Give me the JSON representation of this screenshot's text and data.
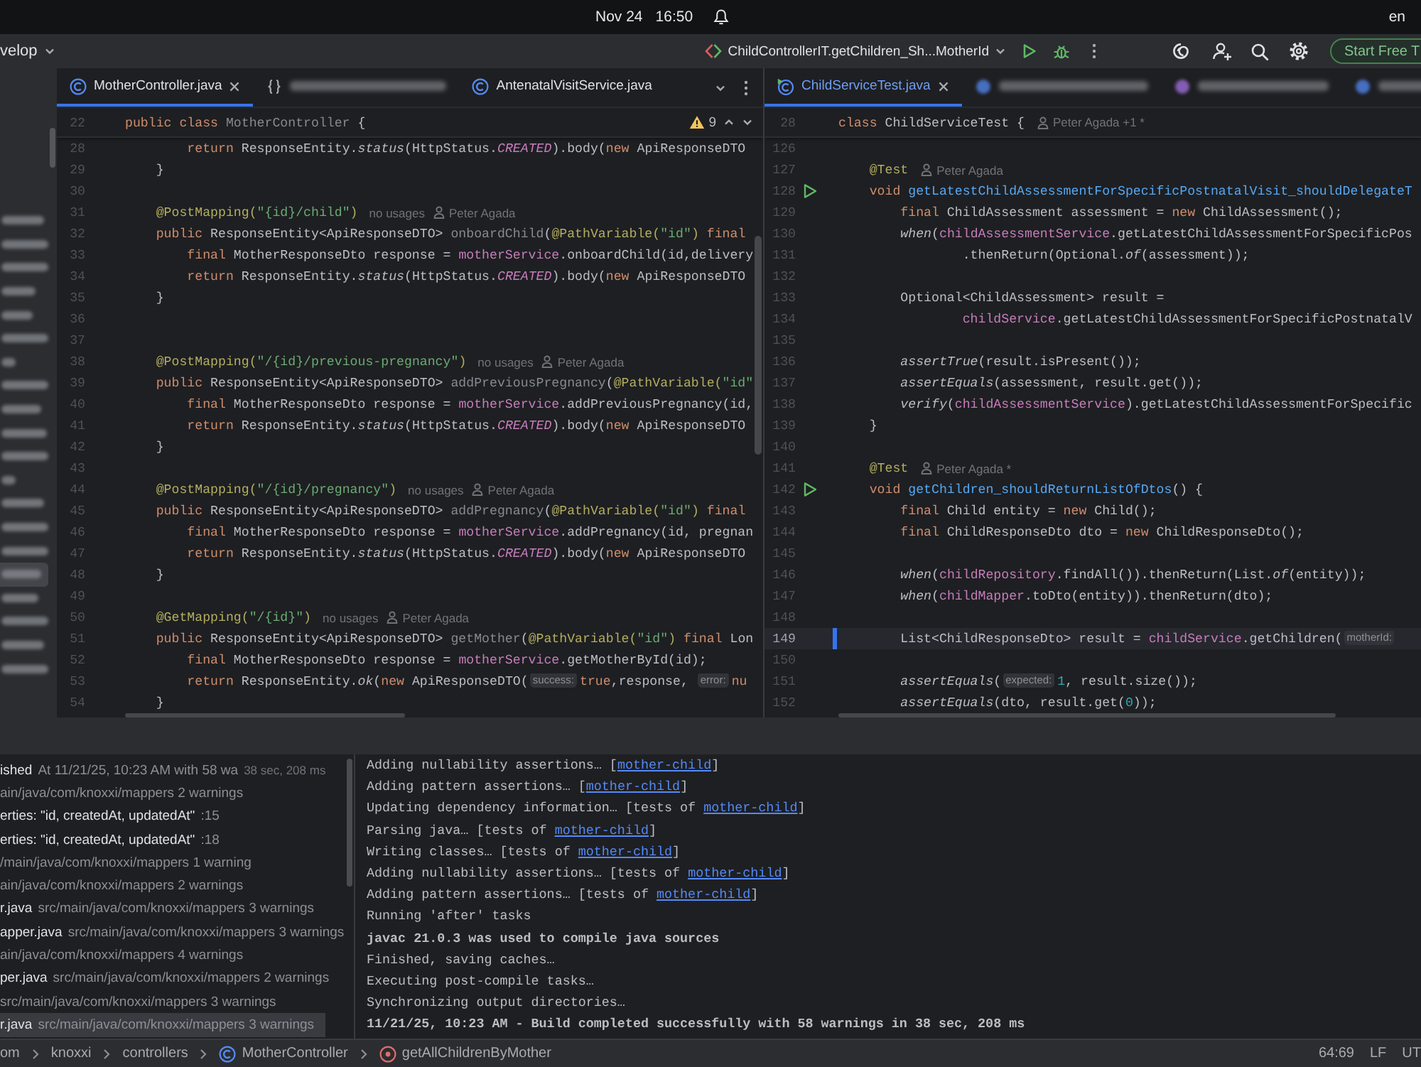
{
  "system_bar": {
    "date": "Nov 24",
    "time": "16:50",
    "language": "en"
  },
  "title_bar": {
    "branch": "velop",
    "run_configuration": "ChildControllerIT.getChildren_Sh...MotherId",
    "trial_button": "Start Free T"
  },
  "project_panel": {
    "items": [
      {
        "selected": false
      },
      {
        "selected": false
      },
      {
        "selected": false
      },
      {
        "selected": false
      },
      {
        "selected": false
      },
      {
        "selected": false
      },
      {
        "selected": false
      },
      {
        "selected": false
      },
      {
        "selected": false
      },
      {
        "selected": false
      },
      {
        "selected": false
      },
      {
        "selected": false
      },
      {
        "selected": false
      },
      {
        "selected": false
      },
      {
        "selected": false
      },
      {
        "selected": true
      },
      {
        "selected": false
      },
      {
        "selected": false
      },
      {
        "selected": false
      },
      {
        "selected": false
      }
    ]
  },
  "left_editor": {
    "tabs": [
      {
        "kind": "class",
        "label": "MotherController.java",
        "selected": true,
        "modified": false,
        "redacted": false
      },
      {
        "kind": "json",
        "selected": false,
        "redacted": true
      },
      {
        "kind": "class",
        "label": "AntenatalVisitService.java",
        "selected": false,
        "modified": false,
        "redacted": false
      }
    ],
    "problems": "9",
    "sticky_line": {
      "number": "22",
      "tokens": [
        {
          "kind": "kw",
          "text": "public class "
        },
        {
          "kind": "unused",
          "text": "MotherController"
        },
        {
          "kind": "plain",
          "text": " {"
        }
      ]
    },
    "lines": [
      {
        "number": "28",
        "tokens": [
          {
            "kind": "kw",
            "text": "        return "
          },
          {
            "kind": "plain",
            "text": "ResponseEntity."
          },
          {
            "kind": "static",
            "text": "status"
          },
          {
            "kind": "plain",
            "text": "(HttpStatus."
          },
          {
            "kind": "const",
            "text": "CREATED"
          },
          {
            "kind": "plain",
            "text": ").body("
          },
          {
            "kind": "kw",
            "text": "new "
          },
          {
            "kind": "plain",
            "text": "ApiResponseDTO"
          }
        ]
      },
      {
        "number": "29",
        "tokens": [
          {
            "kind": "plain",
            "text": "    }"
          }
        ]
      },
      {
        "number": "30"
      },
      {
        "number": "31",
        "tokens": [
          {
            "kind": "ann",
            "text": "    @PostMapping("
          },
          {
            "kind": "str",
            "text": "\"{id}/child\""
          },
          {
            "kind": "ann",
            "text": ")"
          }
        ],
        "usages": "no usages",
        "author": "Peter Agada"
      },
      {
        "number": "32",
        "tokens": [
          {
            "kind": "kw",
            "text": "    public "
          },
          {
            "kind": "plain",
            "text": "ResponseEntity<ApiResponseDTO> "
          },
          {
            "kind": "unused",
            "text": "onboardChild"
          },
          {
            "kind": "plain",
            "text": "("
          },
          {
            "kind": "ann",
            "text": "@PathVariable("
          },
          {
            "kind": "str",
            "text": "\"id\""
          },
          {
            "kind": "ann",
            "text": ")"
          },
          {
            "kind": "kw",
            "text": " final"
          }
        ]
      },
      {
        "number": "33",
        "tokens": [
          {
            "kind": "kw",
            "text": "        final "
          },
          {
            "kind": "plain",
            "text": "MotherResponseDto response = "
          },
          {
            "kind": "field",
            "text": "motherService"
          },
          {
            "kind": "plain",
            "text": ".onboardChild(id,delivery"
          }
        ]
      },
      {
        "number": "34",
        "tokens": [
          {
            "kind": "kw",
            "text": "        return "
          },
          {
            "kind": "plain",
            "text": "ResponseEntity."
          },
          {
            "kind": "static",
            "text": "status"
          },
          {
            "kind": "plain",
            "text": "(HttpStatus."
          },
          {
            "kind": "const",
            "text": "CREATED"
          },
          {
            "kind": "plain",
            "text": ").body("
          },
          {
            "kind": "kw",
            "text": "new "
          },
          {
            "kind": "plain",
            "text": "ApiResponseDTO"
          }
        ]
      },
      {
        "number": "35",
        "tokens": [
          {
            "kind": "plain",
            "text": "    }"
          }
        ]
      },
      {
        "number": "36"
      },
      {
        "number": "37"
      },
      {
        "number": "38",
        "tokens": [
          {
            "kind": "ann",
            "text": "    @PostMapping("
          },
          {
            "kind": "str",
            "text": "\"/{id}/previous-pregnancy\""
          },
          {
            "kind": "ann",
            "text": ")"
          }
        ],
        "usages": "no usages",
        "author": "Peter Agada"
      },
      {
        "number": "39",
        "tokens": [
          {
            "kind": "kw",
            "text": "    public "
          },
          {
            "kind": "plain",
            "text": "ResponseEntity<ApiResponseDTO> "
          },
          {
            "kind": "unused",
            "text": "addPreviousPregnancy"
          },
          {
            "kind": "plain",
            "text": "("
          },
          {
            "kind": "ann",
            "text": "@PathVariable("
          },
          {
            "kind": "str",
            "text": "\"id\""
          }
        ]
      },
      {
        "number": "40",
        "tokens": [
          {
            "kind": "kw",
            "text": "        final "
          },
          {
            "kind": "plain",
            "text": "MotherResponseDto response = "
          },
          {
            "kind": "field",
            "text": "motherService"
          },
          {
            "kind": "plain",
            "text": ".addPreviousPregnancy(id,"
          }
        ]
      },
      {
        "number": "41",
        "tokens": [
          {
            "kind": "kw",
            "text": "        return "
          },
          {
            "kind": "plain",
            "text": "ResponseEntity."
          },
          {
            "kind": "static",
            "text": "status"
          },
          {
            "kind": "plain",
            "text": "(HttpStatus."
          },
          {
            "kind": "const",
            "text": "CREATED"
          },
          {
            "kind": "plain",
            "text": ").body("
          },
          {
            "kind": "kw",
            "text": "new "
          },
          {
            "kind": "plain",
            "text": "ApiResponseDTO"
          }
        ]
      },
      {
        "number": "42",
        "tokens": [
          {
            "kind": "plain",
            "text": "    }"
          }
        ]
      },
      {
        "number": "43"
      },
      {
        "number": "44",
        "tokens": [
          {
            "kind": "ann",
            "text": "    @PostMapping("
          },
          {
            "kind": "str",
            "text": "\"/{id}/pregnancy\""
          },
          {
            "kind": "ann",
            "text": ")"
          }
        ],
        "usages": "no usages",
        "author": "Peter Agada"
      },
      {
        "number": "45",
        "tokens": [
          {
            "kind": "kw",
            "text": "    public "
          },
          {
            "kind": "plain",
            "text": "ResponseEntity<ApiResponseDTO> "
          },
          {
            "kind": "unused",
            "text": "addPregnancy"
          },
          {
            "kind": "plain",
            "text": "("
          },
          {
            "kind": "ann",
            "text": "@PathVariable("
          },
          {
            "kind": "str",
            "text": "\"id\""
          },
          {
            "kind": "ann",
            "text": ")"
          },
          {
            "kind": "kw",
            "text": " final"
          }
        ]
      },
      {
        "number": "46",
        "tokens": [
          {
            "kind": "kw",
            "text": "        final "
          },
          {
            "kind": "plain",
            "text": "MotherResponseDto response = "
          },
          {
            "kind": "field",
            "text": "motherService"
          },
          {
            "kind": "plain",
            "text": ".addPregnancy(id, pregnan"
          }
        ]
      },
      {
        "number": "47",
        "tokens": [
          {
            "kind": "kw",
            "text": "        return "
          },
          {
            "kind": "plain",
            "text": "ResponseEntity."
          },
          {
            "kind": "static",
            "text": "status"
          },
          {
            "kind": "plain",
            "text": "(HttpStatus."
          },
          {
            "kind": "const",
            "text": "CREATED"
          },
          {
            "kind": "plain",
            "text": ").body("
          },
          {
            "kind": "kw",
            "text": "new "
          },
          {
            "kind": "plain",
            "text": "ApiResponseDTO"
          }
        ]
      },
      {
        "number": "48",
        "tokens": [
          {
            "kind": "plain",
            "text": "    }"
          }
        ]
      },
      {
        "number": "49"
      },
      {
        "number": "50",
        "tokens": [
          {
            "kind": "ann",
            "text": "    @GetMapping("
          },
          {
            "kind": "str",
            "text": "\"/{id}\""
          },
          {
            "kind": "ann",
            "text": ")"
          }
        ],
        "usages": "no usages",
        "author": "Peter Agada"
      },
      {
        "number": "51",
        "tokens": [
          {
            "kind": "kw",
            "text": "    public "
          },
          {
            "kind": "plain",
            "text": "ResponseEntity<ApiResponseDTO> "
          },
          {
            "kind": "unused",
            "text": "getMother"
          },
          {
            "kind": "plain",
            "text": "("
          },
          {
            "kind": "ann",
            "text": "@PathVariable("
          },
          {
            "kind": "str",
            "text": "\"id\""
          },
          {
            "kind": "ann",
            "text": ")"
          },
          {
            "kind": "kw",
            "text": " final"
          },
          {
            "kind": "plain",
            "text": " Lon"
          }
        ]
      },
      {
        "number": "52",
        "tokens": [
          {
            "kind": "kw",
            "text": "        final "
          },
          {
            "kind": "plain",
            "text": "MotherResponseDto response = "
          },
          {
            "kind": "field",
            "text": "motherService"
          },
          {
            "kind": "plain",
            "text": ".getMotherById(id);"
          }
        ]
      },
      {
        "number": "53",
        "tokens": [
          {
            "kind": "kw",
            "text": "        return "
          },
          {
            "kind": "plain",
            "text": "ResponseEntity."
          },
          {
            "kind": "static",
            "text": "ok"
          },
          {
            "kind": "plain",
            "text": "("
          },
          {
            "kind": "kw",
            "text": "new "
          },
          {
            "kind": "plain",
            "text": "ApiResponseDTO("
          },
          {
            "kind": "hint",
            "text": "success:"
          },
          {
            "kind": "kw",
            "text": "true"
          },
          {
            "kind": "plain",
            "text": ",response, "
          },
          {
            "kind": "hint",
            "text": "error:"
          },
          {
            "kind": "kw",
            "text": "nu"
          }
        ]
      },
      {
        "number": "54",
        "tokens": [
          {
            "kind": "plain",
            "text": "    }"
          }
        ]
      }
    ]
  },
  "right_editor": {
    "tabs": [
      {
        "kind": "test",
        "label": "ChildServiceTest.java",
        "selected": true,
        "modified": true,
        "redacted": false
      },
      {
        "kind": "class",
        "selected": false,
        "redacted": true
      },
      {
        "kind": "enum",
        "selected": false,
        "redacted": true
      },
      {
        "kind": "class",
        "selected": false,
        "redacted": true
      }
    ],
    "sticky_line": {
      "number": "28",
      "tokens": [
        {
          "kind": "kw",
          "text": "class "
        },
        {
          "kind": "plain",
          "text": "ChildServiceTest {"
        }
      ],
      "author": "Peter Agada +1 *"
    },
    "lines": [
      {
        "number": "126",
        "current": false,
        "changed": false,
        "run": false
      },
      {
        "number": "127",
        "current": false,
        "changed": false,
        "run": false,
        "tokens": [
          {
            "kind": "ann",
            "text": "    @Test"
          }
        ],
        "author": "Peter Agada"
      },
      {
        "number": "128",
        "current": false,
        "changed": false,
        "run": true,
        "tokens": [
          {
            "kind": "kw",
            "text": "    void "
          },
          {
            "kind": "decl",
            "text": "getLatestChildAssessmentForSpecificPostnatalVisit_shouldDelegateT"
          }
        ]
      },
      {
        "number": "129",
        "current": false,
        "changed": false,
        "run": false,
        "tokens": [
          {
            "kind": "kw",
            "text": "        final "
          },
          {
            "kind": "plain",
            "text": "ChildAssessment assessment = "
          },
          {
            "kind": "kw",
            "text": "new "
          },
          {
            "kind": "plain",
            "text": "ChildAssessment();"
          }
        ]
      },
      {
        "number": "130",
        "current": false,
        "changed": false,
        "run": false,
        "tokens": [
          {
            "kind": "static",
            "text": "        when"
          },
          {
            "kind": "plain",
            "text": "("
          },
          {
            "kind": "field",
            "text": "childAssessmentService"
          },
          {
            "kind": "plain",
            "text": ".getLatestChildAssessmentForSpecificPos"
          }
        ]
      },
      {
        "number": "131",
        "current": false,
        "changed": false,
        "run": false,
        "tokens": [
          {
            "kind": "plain",
            "text": "                .thenReturn(Optional."
          },
          {
            "kind": "static",
            "text": "of"
          },
          {
            "kind": "plain",
            "text": "(assessment));"
          }
        ]
      },
      {
        "number": "132",
        "current": false,
        "changed": false,
        "run": false
      },
      {
        "number": "133",
        "current": false,
        "changed": false,
        "run": false,
        "tokens": [
          {
            "kind": "plain",
            "text": "        Optional<ChildAssessment> result ="
          }
        ]
      },
      {
        "number": "134",
        "current": false,
        "changed": false,
        "run": false,
        "tokens": [
          {
            "kind": "field",
            "text": "                childService"
          },
          {
            "kind": "plain",
            "text": ".getLatestChildAssessmentForSpecificPostnatalV"
          }
        ]
      },
      {
        "number": "135",
        "current": false,
        "changed": false,
        "run": false
      },
      {
        "number": "136",
        "current": false,
        "changed": false,
        "run": false,
        "tokens": [
          {
            "kind": "static",
            "text": "        assertTrue"
          },
          {
            "kind": "plain",
            "text": "(result.isPresent());"
          }
        ]
      },
      {
        "number": "137",
        "current": false,
        "changed": false,
        "run": false,
        "tokens": [
          {
            "kind": "static",
            "text": "        assertEquals"
          },
          {
            "kind": "plain",
            "text": "(assessment, result.get());"
          }
        ]
      },
      {
        "number": "138",
        "current": false,
        "changed": false,
        "run": false,
        "tokens": [
          {
            "kind": "static",
            "text": "        verify"
          },
          {
            "kind": "plain",
            "text": "("
          },
          {
            "kind": "field",
            "text": "childAssessmentService"
          },
          {
            "kind": "plain",
            "text": ").getLatestChildAssessmentForSpecific"
          }
        ]
      },
      {
        "number": "139",
        "current": false,
        "changed": false,
        "run": false,
        "tokens": [
          {
            "kind": "plain",
            "text": "    }"
          }
        ]
      },
      {
        "number": "140",
        "current": false,
        "changed": false,
        "run": false
      },
      {
        "number": "141",
        "current": false,
        "changed": false,
        "run": false,
        "tokens": [
          {
            "kind": "ann",
            "text": "    @Test"
          }
        ],
        "author": "Peter Agada *"
      },
      {
        "number": "142",
        "current": false,
        "changed": false,
        "run": true,
        "tokens": [
          {
            "kind": "kw",
            "text": "    void "
          },
          {
            "kind": "decl",
            "text": "getChildren_shouldReturnListOfDtos"
          },
          {
            "kind": "plain",
            "text": "() {"
          }
        ]
      },
      {
        "number": "143",
        "current": false,
        "changed": false,
        "run": false,
        "tokens": [
          {
            "kind": "kw",
            "text": "        final "
          },
          {
            "kind": "plain",
            "text": "Child entity = "
          },
          {
            "kind": "kw",
            "text": "new "
          },
          {
            "kind": "plain",
            "text": "Child();"
          }
        ]
      },
      {
        "number": "144",
        "current": false,
        "changed": false,
        "run": false,
        "tokens": [
          {
            "kind": "kw",
            "text": "        final "
          },
          {
            "kind": "plain",
            "text": "ChildResponseDto dto = "
          },
          {
            "kind": "kw",
            "text": "new "
          },
          {
            "kind": "plain",
            "text": "ChildResponseDto();"
          }
        ]
      },
      {
        "number": "145",
        "current": false,
        "changed": false,
        "run": false
      },
      {
        "number": "146",
        "current": false,
        "changed": false,
        "run": false,
        "tokens": [
          {
            "kind": "static",
            "text": "        when"
          },
          {
            "kind": "plain",
            "text": "("
          },
          {
            "kind": "field",
            "text": "childRepository"
          },
          {
            "kind": "plain",
            "text": ".findAll()).thenReturn(List."
          },
          {
            "kind": "static",
            "text": "of"
          },
          {
            "kind": "plain",
            "text": "(entity));"
          }
        ]
      },
      {
        "number": "147",
        "current": false,
        "changed": false,
        "run": false,
        "tokens": [
          {
            "kind": "static",
            "text": "        when"
          },
          {
            "kind": "plain",
            "text": "("
          },
          {
            "kind": "field",
            "text": "childMapper"
          },
          {
            "kind": "plain",
            "text": ".toDto(entity)).thenReturn(dto);"
          }
        ]
      },
      {
        "number": "148",
        "current": false,
        "changed": false,
        "run": false
      },
      {
        "number": "149",
        "current": true,
        "changed": true,
        "run": false,
        "tokens": [
          {
            "kind": "plain",
            "text": "        List<ChildResponseDto> result = "
          },
          {
            "kind": "field",
            "text": "childService"
          },
          {
            "kind": "plain",
            "text": ".getChildren("
          },
          {
            "kind": "hint",
            "text": "motherId:"
          }
        ]
      },
      {
        "number": "150",
        "current": false,
        "changed": false,
        "run": false
      },
      {
        "number": "151",
        "current": false,
        "changed": false,
        "run": false,
        "tokens": [
          {
            "kind": "static",
            "text": "        assertEquals"
          },
          {
            "kind": "plain",
            "text": "("
          },
          {
            "kind": "hint",
            "text": "expected:"
          },
          {
            "kind": "num",
            "text": "1"
          },
          {
            "kind": "plain",
            "text": ", result.size());"
          }
        ]
      },
      {
        "number": "152",
        "current": false,
        "changed": false,
        "run": false,
        "tokens": [
          {
            "kind": "static",
            "text": "        assertEquals"
          },
          {
            "kind": "plain",
            "text": "(dto, result.get("
          },
          {
            "kind": "num",
            "text": "0"
          },
          {
            "kind": "plain",
            "text": "));"
          }
        ]
      }
    ]
  },
  "build_panel": {
    "tree": [
      {
        "selected": false,
        "parts": [
          {
            "kind": "name",
            "text": "ished"
          },
          {
            "kind": "detail",
            "text": "At 11/21/25, 10:23 AM with 58 wa"
          },
          {
            "kind": "time",
            "text": "38 sec, 208 ms"
          }
        ]
      },
      {
        "selected": false,
        "parts": [
          {
            "kind": "detail",
            "text": "ain/java/com/knoxxi/mappers 2 warnings"
          }
        ]
      },
      {
        "selected": false,
        "parts": [
          {
            "kind": "name",
            "text": "erties: \"id, createdAt, updatedAt\""
          },
          {
            "kind": "detail",
            "text": ":15"
          }
        ]
      },
      {
        "selected": false,
        "parts": [
          {
            "kind": "name",
            "text": "erties: \"id, createdAt, updatedAt\""
          },
          {
            "kind": "detail",
            "text": ":18"
          }
        ]
      },
      {
        "selected": false,
        "parts": [
          {
            "kind": "detail",
            "text": "/main/java/com/knoxxi/mappers 1 warning"
          }
        ]
      },
      {
        "selected": false,
        "parts": [
          {
            "kind": "detail",
            "text": "ain/java/com/knoxxi/mappers 2 warnings"
          }
        ]
      },
      {
        "selected": false,
        "parts": [
          {
            "kind": "name",
            "text": "r.java"
          },
          {
            "kind": "detail",
            "text": "src/main/java/com/knoxxi/mappers 3 warnings"
          }
        ]
      },
      {
        "selected": false,
        "parts": [
          {
            "kind": "name",
            "text": "apper.java"
          },
          {
            "kind": "detail",
            "text": "src/main/java/com/knoxxi/mappers 3 warnings"
          }
        ]
      },
      {
        "selected": false,
        "parts": [
          {
            "kind": "detail",
            "text": "ain/java/com/knoxxi/mappers 4 warnings"
          }
        ]
      },
      {
        "selected": false,
        "parts": [
          {
            "kind": "name",
            "text": "per.java"
          },
          {
            "kind": "detail",
            "text": "src/main/java/com/knoxxi/mappers 2 warnings"
          }
        ]
      },
      {
        "selected": false,
        "parts": [
          {
            "kind": "detail",
            "text": "src/main/java/com/knoxxi/mappers 3 warnings"
          }
        ]
      },
      {
        "selected": true,
        "parts": [
          {
            "kind": "name",
            "text": "r.java"
          },
          {
            "kind": "detail",
            "text": "src/main/java/com/knoxxi/mappers 3 warnings"
          }
        ]
      }
    ],
    "console": [
      {
        "bold": false,
        "text": "Adding nullability assertions… [",
        "link": "mother-child",
        "after": "]"
      },
      {
        "bold": false,
        "text": "Adding pattern assertions… [",
        "link": "mother-child",
        "after": "]"
      },
      {
        "bold": false,
        "text": "Updating dependency information… [tests of ",
        "link": "mother-child",
        "after": "]"
      },
      {
        "bold": false,
        "text": "Parsing java… [tests of ",
        "link": "mother-child",
        "after": "]"
      },
      {
        "bold": false,
        "text": "Writing classes… [tests of ",
        "link": "mother-child",
        "after": "]"
      },
      {
        "bold": false,
        "text": "Adding nullability assertions… [tests of ",
        "link": "mother-child",
        "after": "]"
      },
      {
        "bold": false,
        "text": "Adding pattern assertions… [tests of ",
        "link": "mother-child",
        "after": "]"
      },
      {
        "bold": false,
        "text": "Running 'after' tasks"
      },
      {
        "bold": true,
        "text": "javac 21.0.3 was used to compile java sources"
      },
      {
        "bold": false,
        "text": "Finished, saving caches…"
      },
      {
        "bold": false,
        "text": "Executing post-compile tasks…"
      },
      {
        "bold": false,
        "text": "Synchronizing output directories…"
      },
      {
        "bold": true,
        "text": "11/21/25, 10:23 AM - Build completed successfully with 58 warnings in 38 sec, 208 ms"
      }
    ]
  },
  "status_bar": {
    "breadcrumbs": [
      {
        "kind": "package",
        "label": "om"
      },
      {
        "kind": "package",
        "label": "knoxxi"
      },
      {
        "kind": "package",
        "label": "controllers"
      },
      {
        "kind": "class",
        "label": "MotherController"
      },
      {
        "kind": "method",
        "label": "getAllChildrenByMother"
      }
    ],
    "position": "64:69",
    "line_separator": "LF",
    "encoding": "UT"
  }
}
